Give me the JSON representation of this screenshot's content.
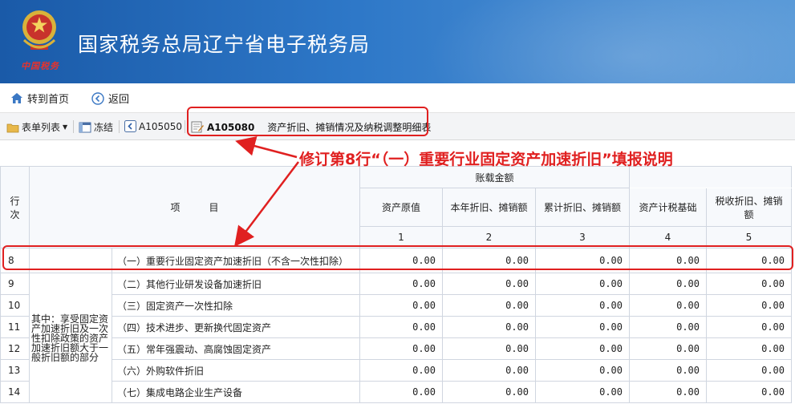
{
  "header": {
    "logo_text": "中国税务",
    "title": "国家税务总局辽宁省电子税务局"
  },
  "nav": {
    "home_label": "转到首页",
    "back_label": "返回"
  },
  "toolbar": {
    "form_list_label": "表单列表",
    "freeze_label": "冻结",
    "prev_form_label": "A105050",
    "current_form_code": "A105080",
    "current_form_name": "资产折旧、摊销情况及纳税调整明细表"
  },
  "annotation": {
    "text": "修订第8行“（一）重要行业固定资产加速折旧”填报说明"
  },
  "table": {
    "row_no_header": "行次",
    "item_header": "项　　　目",
    "group_header": "账载金额",
    "columns": [
      "资产原值",
      "本年折旧、摊销额",
      "累计折旧、摊销额",
      "资产计税基础",
      "税收折旧、摊销额"
    ],
    "column_numbers": [
      "1",
      "2",
      "3",
      "4",
      "5"
    ],
    "side_note": "其中：享受固定资产加速折旧及一次性扣除政策的资产加速折旧额大于一般折旧额的部分",
    "rows": [
      {
        "no": "8",
        "item": "（一）重要行业固定资产加速折旧（不含一次性扣除）",
        "values": [
          "0.00",
          "0.00",
          "0.00",
          "0.00",
          "0.00"
        ]
      },
      {
        "no": "9",
        "item": "（二）其他行业研发设备加速折旧",
        "values": [
          "0.00",
          "0.00",
          "0.00",
          "0.00",
          "0.00"
        ]
      },
      {
        "no": "10",
        "item": "（三）固定资产一次性扣除",
        "values": [
          "0.00",
          "0.00",
          "0.00",
          "0.00",
          "0.00"
        ]
      },
      {
        "no": "11",
        "item": "（四）技术进步、更新换代固定资产",
        "values": [
          "0.00",
          "0.00",
          "0.00",
          "0.00",
          "0.00"
        ]
      },
      {
        "no": "12",
        "item": "（五）常年强震动、高腐蚀固定资产",
        "values": [
          "0.00",
          "0.00",
          "0.00",
          "0.00",
          "0.00"
        ]
      },
      {
        "no": "13",
        "item": "（六）外购软件折旧",
        "values": [
          "0.00",
          "0.00",
          "0.00",
          "0.00",
          "0.00"
        ]
      },
      {
        "no": "14",
        "item": "（七）集成电路企业生产设备",
        "values": [
          "0.00",
          "0.00",
          "0.00",
          "0.00",
          "0.00"
        ]
      }
    ]
  },
  "colors": {
    "banner": "#2e78c8",
    "highlight": "#e02020",
    "icon_blue": "#3b78c4"
  }
}
